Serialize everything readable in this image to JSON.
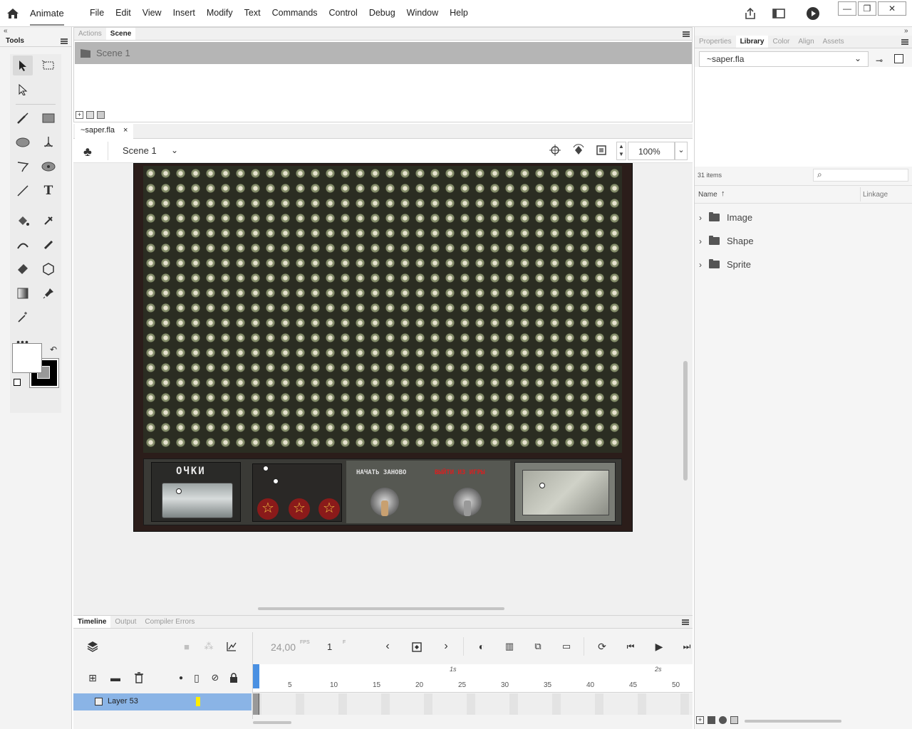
{
  "app": {
    "name": "Animate"
  },
  "menu": [
    "File",
    "Edit",
    "View",
    "Insert",
    "Modify",
    "Text",
    "Commands",
    "Control",
    "Debug",
    "Window",
    "Help"
  ],
  "window_controls": {
    "minimize": "—",
    "restore": "❐",
    "close": "✕"
  },
  "tools_panel": {
    "title": "Tools",
    "collapse": "«"
  },
  "scene_panel": {
    "tabs": [
      "Actions",
      "Scene"
    ],
    "active_tab": "Scene",
    "scene_name": "Scene 1"
  },
  "document": {
    "tab_name": "~saper.fla",
    "close": "×",
    "scene_label": "Scene 1",
    "zoom": "100%"
  },
  "game": {
    "score_title": "ОЧКИ",
    "restart_label": "НАЧАТЬ ЗАНОВО",
    "red_label": "ВЫЙТИ ИЗ ИГРЫ",
    "stars": [
      "☆",
      "☆",
      "☆"
    ]
  },
  "timeline": {
    "tabs": [
      "Timeline",
      "Output",
      "Compiler Errors"
    ],
    "active_tab": "Timeline",
    "fps": "24,00",
    "fps_unit": "FPS",
    "frame": "1",
    "frame_unit": "F",
    "seconds": [
      "1s",
      "2s"
    ],
    "frame_numbers": [
      "5",
      "10",
      "15",
      "20",
      "25",
      "30",
      "35",
      "40",
      "45",
      "50"
    ],
    "layer_name": "Layer 53",
    "layer_color": "#ffee00"
  },
  "right_panel": {
    "tabs": [
      "Properties",
      "Library",
      "Color",
      "Align",
      "Assets"
    ],
    "active_tab": "Library",
    "library_file": "~saper.fla",
    "items_count": "31 items",
    "search_placeholder": "",
    "col_name": "Name",
    "col_linkage": "Linkage",
    "folders": [
      "Image",
      "Shape",
      "Sprite"
    ]
  }
}
